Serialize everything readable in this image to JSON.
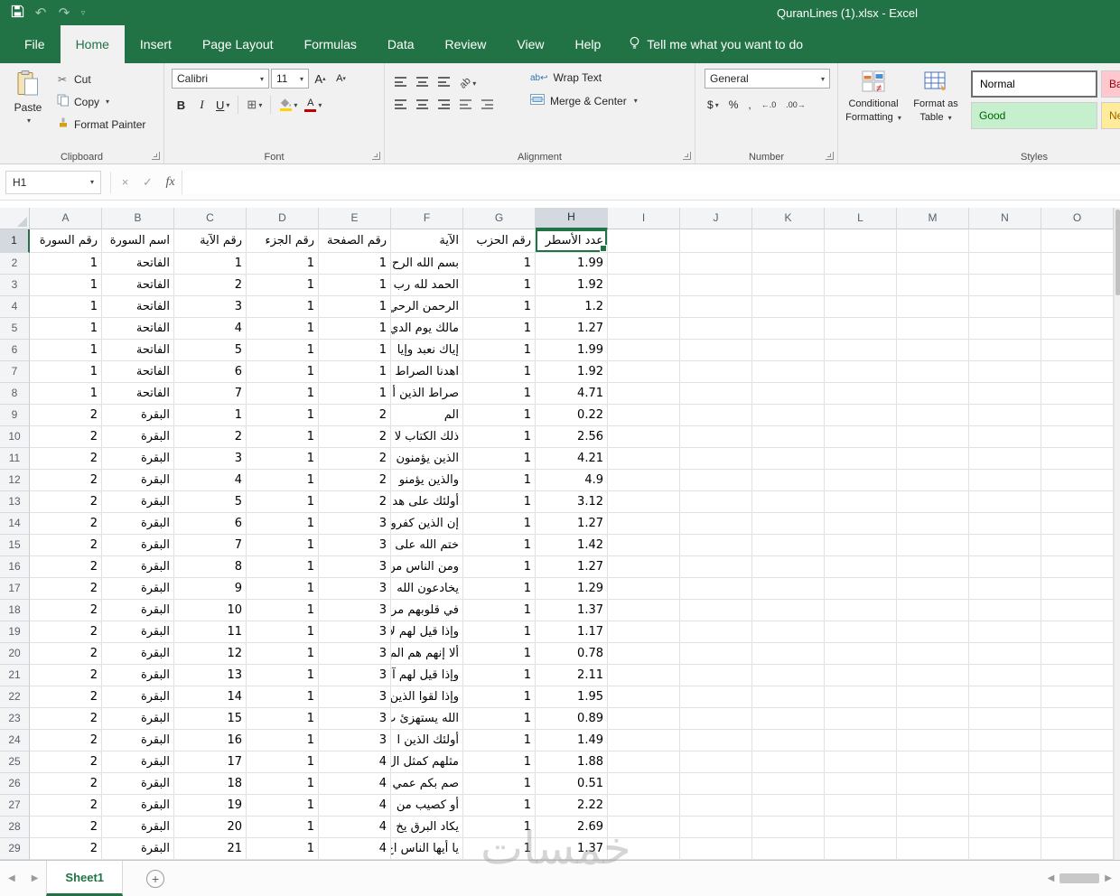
{
  "titlebar": {
    "title": "QuranLines (1).xlsx  -  Excel"
  },
  "ribbon_tabs": [
    "File",
    "Home",
    "Insert",
    "Page Layout",
    "Formulas",
    "Data",
    "Review",
    "View",
    "Help"
  ],
  "tell_me": "Tell me what you want to do",
  "icons": {
    "undo": "↶",
    "redo": "↷",
    "qat_more": "▿",
    "cut": "✂",
    "borders": "⊞",
    "letter_a": "A",
    "tri_up": "▴",
    "tri_down": "▾",
    "bold": "B",
    "italic": "I",
    "underline": "U",
    "dollar": "$",
    "percent": "%",
    "comma": ",",
    "inc_decimal": "←.0",
    "dec_decimal": ".00→",
    "cancel": "×",
    "check": "✓",
    "prev_sheet": "◀",
    "next_sheet": "▶",
    "new_sheet": "+",
    "wrap_ab": "ab",
    "wrap_arrow": "↩",
    "orientation_ab": "ab",
    "merge_icon": "⊟"
  },
  "ribbon": {
    "clipboard": {
      "group": "Clipboard",
      "paste": "Paste",
      "cut": "Cut",
      "copy": "Copy",
      "format_painter": "Format Painter"
    },
    "font": {
      "group": "Font",
      "name": "Calibri",
      "size": "11"
    },
    "alignment": {
      "group": "Alignment",
      "wrap": "Wrap Text",
      "merge": "Merge & Center"
    },
    "number": {
      "group": "Number",
      "format": "General"
    },
    "styles": {
      "group": "Styles",
      "conditional_line1": "Conditional",
      "conditional_line2": "Formatting",
      "format_table_line1": "Format as",
      "format_table_line2": "Table",
      "cells": [
        {
          "label": "Normal",
          "bg": "#ffffff",
          "fg": "#000000"
        },
        {
          "label": "Bad",
          "bg": "#ffc7ce",
          "fg": "#9c0006"
        },
        {
          "label": "Good",
          "bg": "#c6efce",
          "fg": "#006100"
        },
        {
          "label": "Neutral",
          "bg": "#ffeb9c",
          "fg": "#9c6500"
        }
      ]
    }
  },
  "formula_bar": {
    "name_box": "H1",
    "fx": "fx",
    "value": ""
  },
  "sheet": {
    "columns": [
      "A",
      "B",
      "C",
      "D",
      "E",
      "F",
      "G",
      "H",
      "I",
      "J",
      "K",
      "L",
      "M",
      "N",
      "O"
    ],
    "selected_column": "H",
    "selected_row": 1,
    "selected_cell": "H1",
    "header_row": [
      "رقم السورة",
      "اسم السورة",
      "رقم الآية",
      "رقم الجزء",
      "رقم الصفحة",
      "الآية",
      "رقم الحزب",
      "عدد الأسطر"
    ],
    "rows": [
      {
        "n": 2,
        "cells": [
          "1",
          "الفاتحة",
          "1",
          "1",
          "1",
          "بسم الله الرح",
          "1",
          "1.99"
        ]
      },
      {
        "n": 3,
        "cells": [
          "1",
          "الفاتحة",
          "2",
          "1",
          "1",
          "الحمد لله رب",
          "1",
          "1.92"
        ]
      },
      {
        "n": 4,
        "cells": [
          "1",
          "الفاتحة",
          "3",
          "1",
          "1",
          "الرحمن الرحي",
          "1",
          "1.2"
        ]
      },
      {
        "n": 5,
        "cells": [
          "1",
          "الفاتحة",
          "4",
          "1",
          "1",
          "مالك يوم الدي",
          "1",
          "1.27"
        ]
      },
      {
        "n": 6,
        "cells": [
          "1",
          "الفاتحة",
          "5",
          "1",
          "1",
          "إياك نعبد وإيا",
          "1",
          "1.99"
        ]
      },
      {
        "n": 7,
        "cells": [
          "1",
          "الفاتحة",
          "6",
          "1",
          "1",
          "اهدنا الصراط",
          "1",
          "1.92"
        ]
      },
      {
        "n": 8,
        "cells": [
          "1",
          "الفاتحة",
          "7",
          "1",
          "1",
          "صراط الذين أ",
          "1",
          "4.71"
        ]
      },
      {
        "n": 9,
        "cells": [
          "2",
          "البقرة",
          "1",
          "1",
          "2",
          "الم",
          "1",
          "0.22"
        ]
      },
      {
        "n": 10,
        "cells": [
          "2",
          "البقرة",
          "2",
          "1",
          "2",
          "ذلك الكتاب لا",
          "1",
          "2.56"
        ]
      },
      {
        "n": 11,
        "cells": [
          "2",
          "البقرة",
          "3",
          "1",
          "2",
          "الذين يؤمنون",
          "1",
          "4.21"
        ]
      },
      {
        "n": 12,
        "cells": [
          "2",
          "البقرة",
          "4",
          "1",
          "2",
          "والذين يؤمنو",
          "1",
          "4.9"
        ]
      },
      {
        "n": 13,
        "cells": [
          "2",
          "البقرة",
          "5",
          "1",
          "2",
          "أولئك على هد",
          "1",
          "3.12"
        ]
      },
      {
        "n": 14,
        "cells": [
          "2",
          "البقرة",
          "6",
          "1",
          "3",
          "إن الذين كفرو",
          "1",
          "1.27"
        ]
      },
      {
        "n": 15,
        "cells": [
          "2",
          "البقرة",
          "7",
          "1",
          "3",
          "ختم الله على",
          "1",
          "1.42"
        ]
      },
      {
        "n": 16,
        "cells": [
          "2",
          "البقرة",
          "8",
          "1",
          "3",
          "ومن الناس من",
          "1",
          "1.27"
        ]
      },
      {
        "n": 17,
        "cells": [
          "2",
          "البقرة",
          "9",
          "1",
          "3",
          "يخادعون الله",
          "1",
          "1.29"
        ]
      },
      {
        "n": 18,
        "cells": [
          "2",
          "البقرة",
          "10",
          "1",
          "3",
          "في قلوبهم مر",
          "1",
          "1.37"
        ]
      },
      {
        "n": 19,
        "cells": [
          "2",
          "البقرة",
          "11",
          "1",
          "3",
          "وإذا قيل لهم لا",
          "1",
          "1.17"
        ]
      },
      {
        "n": 20,
        "cells": [
          "2",
          "البقرة",
          "12",
          "1",
          "3",
          "ألا إنهم هم الم",
          "1",
          "0.78"
        ]
      },
      {
        "n": 21,
        "cells": [
          "2",
          "البقرة",
          "13",
          "1",
          "3",
          "وإذا قيل لهم آ",
          "1",
          "2.11"
        ]
      },
      {
        "n": 22,
        "cells": [
          "2",
          "البقرة",
          "14",
          "1",
          "3",
          "وإذا لقوا الذين",
          "1",
          "1.95"
        ]
      },
      {
        "n": 23,
        "cells": [
          "2",
          "البقرة",
          "15",
          "1",
          "3",
          "الله يستهزئ ب",
          "1",
          "0.89"
        ]
      },
      {
        "n": 24,
        "cells": [
          "2",
          "البقرة",
          "16",
          "1",
          "3",
          "أولئك الذين ا",
          "1",
          "1.49"
        ]
      },
      {
        "n": 25,
        "cells": [
          "2",
          "البقرة",
          "17",
          "1",
          "4",
          "مثلهم كمثل ال",
          "1",
          "1.88"
        ]
      },
      {
        "n": 26,
        "cells": [
          "2",
          "البقرة",
          "18",
          "1",
          "4",
          "صم بكم عمي",
          "1",
          "0.51"
        ]
      },
      {
        "n": 27,
        "cells": [
          "2",
          "البقرة",
          "19",
          "1",
          "4",
          "أو كصيب من",
          "1",
          "2.22"
        ]
      },
      {
        "n": 28,
        "cells": [
          "2",
          "البقرة",
          "20",
          "1",
          "4",
          "يكاد البرق يخ",
          "1",
          "2.69"
        ]
      },
      {
        "n": 29,
        "cells": [
          "2",
          "البقرة",
          "21",
          "1",
          "4",
          "يا أيها الناس اع",
          "1",
          "1.37"
        ]
      }
    ]
  },
  "sheet_bar": {
    "active_tab": "Sheet1"
  },
  "watermark": "خمسات",
  "colors": {
    "excel_green": "#217346",
    "ribbon_bg": "#f1f1f1",
    "selection_border": "#217346"
  }
}
